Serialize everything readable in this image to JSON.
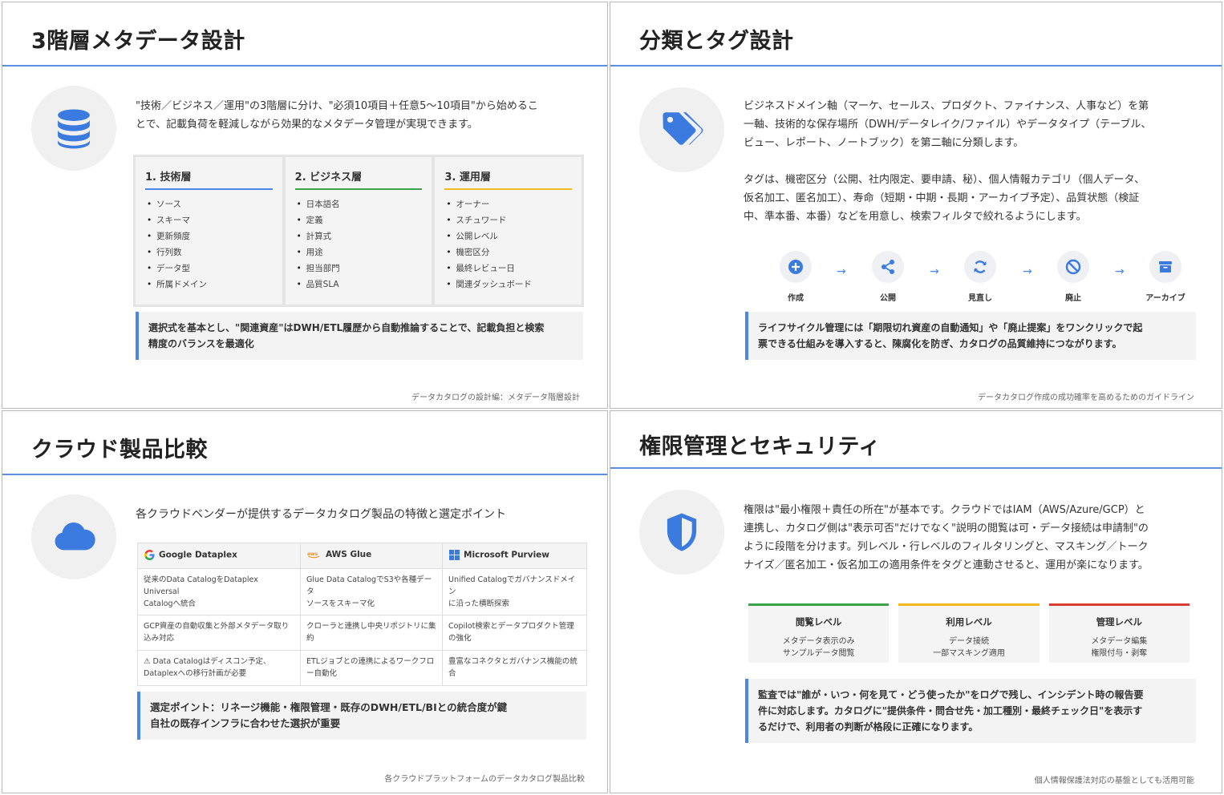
{
  "colors": {
    "accent": "#4a86e8",
    "green": "#3aa34a",
    "yellow": "#f2b81f",
    "red": "#d93b36",
    "rule": "#5b8fe0"
  },
  "slide1": {
    "title": "3階層メタデータ設計",
    "icon": "database-icon",
    "lead_line1": "\"技術／ビジネス／運用\"の3階層に分け、\"必須10項目＋任意5〜10項目\"から始めるこ",
    "lead_line2": "とで、記載負荷を軽減しながら効果的なメタデータ管理が実現できます。",
    "cards": [
      {
        "heading": "1. 技術層",
        "items": [
          "ソース",
          "スキーマ",
          "更新頻度",
          "行列数",
          "データ型",
          "所属ドメイン"
        ]
      },
      {
        "heading": "2. ビジネス層",
        "items": [
          "日本語名",
          "定義",
          "計算式",
          "用途",
          "担当部門",
          "品質SLA"
        ]
      },
      {
        "heading": "3. 運用層",
        "items": [
          "オーナー",
          "スチュワード",
          "公開レベル",
          "機密区分",
          "最終レビュー日",
          "関連ダッシュボード"
        ]
      }
    ],
    "callout_line1": "選択式を基本とし、\"関連資産\"はDWH/ETL履歴から自動推論することで、記載負担と検索",
    "callout_line2": "精度のバランスを最適化",
    "footer": "データカタログの設計編：メタデータ階層設計"
  },
  "slide2": {
    "title": "分類とタグ設計",
    "icon": "tags-icon",
    "para1_line1": "ビジネスドメイン軸（マーケ、セールス、プロダクト、ファイナンス、人事など）を第",
    "para1_line2": "一軸、技術的な保存場所（DWH/データレイク/ファイル）やデータタイプ（テーブル、",
    "para1_line3": "ビュー、レポート、ノートブック）を第二軸に分類します。",
    "para2_line1": "タグは、機密区分（公開、社内限定、要申請、秘）、個人情報カテゴリ（個人データ、",
    "para2_line2": "仮名加工、匿名加工）、寿命（短期・中期・長期・アーカイブ予定）、品質状態（検証",
    "para2_line3": "中、準本番、本番）などを用意し、検索フィルタで絞れるようにします。",
    "lifecycle": [
      {
        "label": "作成",
        "icon": "plus-circle-icon"
      },
      {
        "label": "公開",
        "icon": "share-icon"
      },
      {
        "label": "見直し",
        "icon": "refresh-icon"
      },
      {
        "label": "廃止",
        "icon": "ban-icon"
      },
      {
        "label": "アーカイブ",
        "icon": "archive-icon"
      }
    ],
    "arrow": "→",
    "callout_line1": "ライフサイクル管理には「期限切れ資産の自動通知」や「廃止提案」をワンクリックで起",
    "callout_line2": "票できる仕組みを導入すると、陳腐化を防ぎ、カタログの品質維持につながります。",
    "footer": "データカタログ作成の成功確率を高めるためのガイドライン"
  },
  "slide3": {
    "title": "クラウド製品比較",
    "icon": "cloud-icon",
    "lead": "各クラウドベンダーが提供するデータカタログ製品の特徴と選定ポイント",
    "vendors": [
      {
        "name": "Google Dataplex",
        "logo": "google-logo-icon"
      },
      {
        "name": "AWS Glue",
        "logo": "aws-logo-icon"
      },
      {
        "name": "Microsoft Purview",
        "logo": "microsoft-logo-icon"
      }
    ],
    "rows": [
      [
        {
          "l1": "従来のData CatalogをDataplex Universal",
          "l2": "Catalogへ統合"
        },
        {
          "l1": "Glue Data CatalogでS3や各種データ",
          "l2": "ソースをスキーマ化"
        },
        {
          "l1": "Unified Catalogでガバナンスドメイン",
          "l2": "に沿った横断探索"
        }
      ],
      [
        {
          "l1": "GCP資産の自動収集と外部メタデータ取り",
          "l2": "込み対応"
        },
        {
          "l1": "クローラと連携し中央リポジトリに集",
          "l2": "約"
        },
        {
          "l1": "Copilot検索とデータプロダクト管理",
          "l2": "の強化"
        }
      ],
      [
        {
          "l1": "⚠ Data Catalogはディスコン予定、",
          "l2": "Dataplexへの移行計画が必要"
        },
        {
          "l1": "ETLジョブとの連携によるワークフロ",
          "l2": "ー自動化"
        },
        {
          "l1": "豊富なコネクタとガバナンス機能の統",
          "l2": "合"
        }
      ]
    ],
    "callout_line1": "選定ポイント：リネージ機能・権限管理・既存のDWH/ETL/BIとの統合度が鍵",
    "callout_line2": "自社の既存インフラに合わせた選択が重要",
    "footer": "各クラウドプラットフォームのデータカタログ製品比較"
  },
  "slide4": {
    "title": "権限管理とセキュリティ",
    "icon": "shield-icon",
    "lead_line1": "権限は\"最小権限＋責任の所在\"が基本です。クラウドではIAM（AWS/Azure/GCP）と",
    "lead_line2": "連携し、カタログ側は\"表示可否\"だけでなく\"説明の閲覧は可・データ接続は申請制\"の",
    "lead_line3": "ように段階を分けます。列レベル・行レベルのフィルタリングと、マスキング／トーク",
    "lead_line4": "ナイズ／匿名加工・仮名加工の適用条件をタグと連動させると、運用が楽になります。",
    "levels": [
      {
        "heading": "閲覧レベル",
        "d1": "メタデータ表示のみ",
        "d2": "サンプルデータ閲覧"
      },
      {
        "heading": "利用レベル",
        "d1": "データ接続",
        "d2": "一部マスキング適用"
      },
      {
        "heading": "管理レベル",
        "d1": "メタデータ編集",
        "d2": "権限付与・剥奪"
      }
    ],
    "callout_line1": "監査では\"誰が・いつ・何を見て・どう使ったか\"をログで残し、インシデント時の報告要",
    "callout_line2": "件に対応します。カタログに\"提供条件・問合せ先・加工種別・最終チェック日\"を表示す",
    "callout_line3": "るだけで、利用者の判断が格段に正確になります。",
    "footer": "個人情報保護法対応の基盤としても活用可能"
  }
}
